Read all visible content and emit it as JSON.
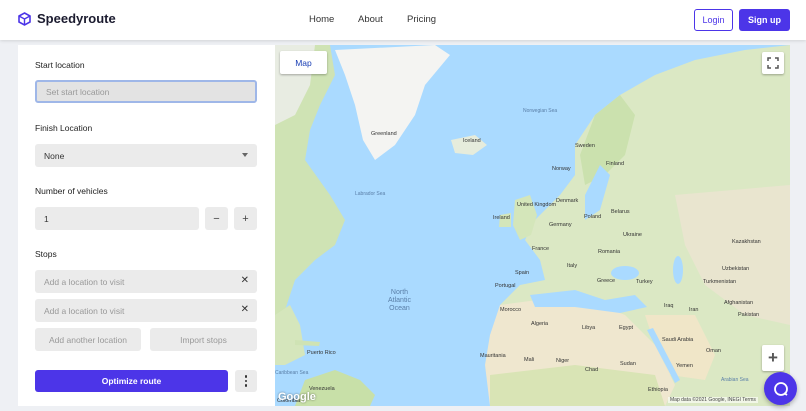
{
  "header": {
    "brand": "Speedyroute",
    "nav": [
      "Home",
      "About",
      "Pricing"
    ],
    "login_label": "Login",
    "signup_label": "Sign up"
  },
  "form": {
    "start_label": "Start location",
    "start_placeholder": "Set start location",
    "finish_label": "Finish Location",
    "finish_value": "None",
    "vehicles_label": "Number of vehicles",
    "vehicles_value": "1",
    "minus": "−",
    "plus": "+",
    "stops_label": "Stops",
    "stops": [
      {
        "placeholder": "Add a location to visit"
      },
      {
        "placeholder": "Add a location to visit"
      }
    ],
    "add_another": "Add another location",
    "import_stops": "Import stops",
    "optimize_label": "Optimize route"
  },
  "map": {
    "tab_label": "Map",
    "zoom_in": "+",
    "attribution": "Map data ©2021 Google, INEGI  Terms",
    "logo_text": "Google",
    "places": [
      "Greenland",
      "Iceland",
      "Norwegian Sea",
      "Sweden",
      "Finland",
      "Norway",
      "Labrador Sea",
      "Ireland",
      "United Kingdom",
      "Denmark",
      "Poland",
      "Belarus",
      "Germany",
      "Ukraine",
      "Kazakhstan",
      "France",
      "Romania",
      "Spain",
      "Italy",
      "Portugal",
      "Greece",
      "Turkey",
      "Uzbekistan",
      "Turkmenistan",
      "Morocco",
      "Algeria",
      "Libya",
      "Egypt",
      "Iraq",
      "Iran",
      "Afghanistan",
      "Pakistan",
      "Saudi Arabia",
      "Mauritania",
      "Mali",
      "Niger",
      "Chad",
      "Sudan",
      "Oman",
      "Yemen",
      "Ethiopia",
      "Puerto Rico",
      "Caribbean Sea",
      "Venezuela",
      "Colombia",
      "Arabian Sea"
    ],
    "ocean_label": "North\nAtlantic\nOcean"
  }
}
